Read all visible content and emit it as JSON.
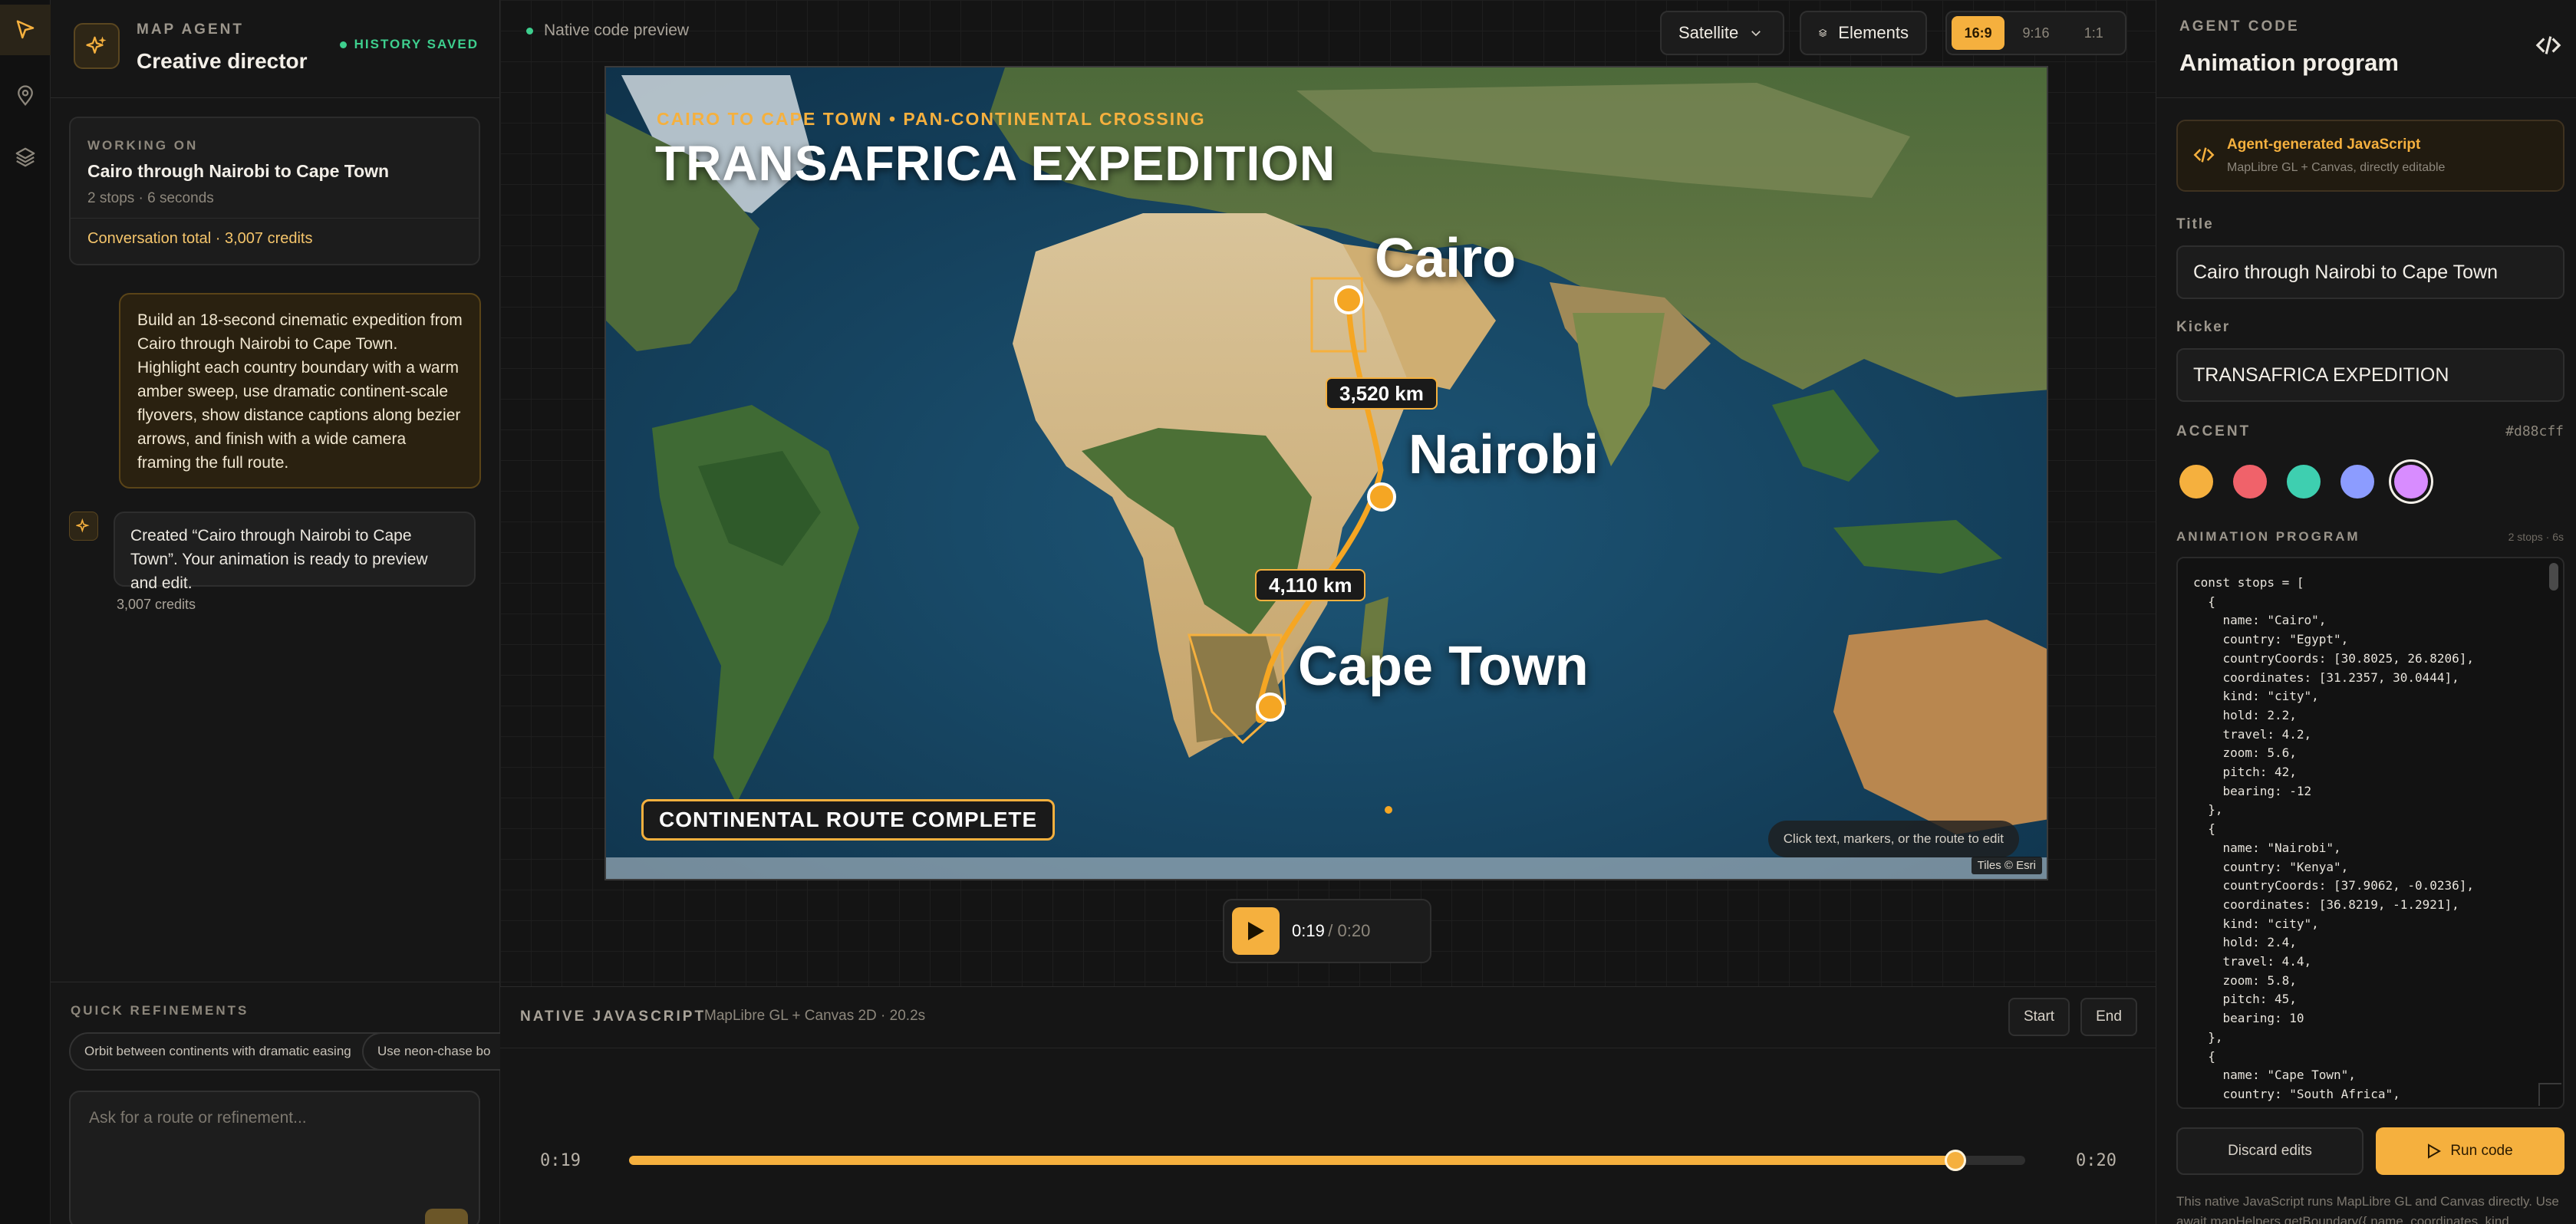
{
  "rail": {
    "items": [
      "cursor-icon",
      "map-pin-icon",
      "layers-icon"
    ]
  },
  "chat": {
    "kicker": "MAP AGENT",
    "title": "Creative director",
    "status": "HISTORY SAVED",
    "working_on": {
      "label": "WORKING ON",
      "title": "Cairo through Nairobi to Cape Town",
      "meta": "2 stops · 6 seconds",
      "total": "Conversation total · 3,007 credits"
    },
    "user_message": "Build an 18-second cinematic expedition from Cairo through Nairobi to Cape Town. Highlight each country boundary with a warm amber sweep, use dramatic continent-scale flyovers, show distance captions along bezier arrows, and finish with a wide camera framing the full route.",
    "agent_message": "Created “Cairo through Nairobi to Cape Town”. Your animation is ready to preview and edit.",
    "agent_credits": "3,007 credits",
    "refinements": {
      "label": "QUICK REFINEMENTS",
      "chips": [
        "Orbit between continents with dramatic easing",
        "Use neon-chase bo"
      ]
    },
    "prompt_placeholder": "Ask for a route or refinement..."
  },
  "stage": {
    "preview_label": "Native code preview",
    "basemap": "Satellite",
    "elements_label": "Elements",
    "ratios": [
      "16:9",
      "9:16",
      "1:1"
    ],
    "active_ratio": "16:9"
  },
  "map": {
    "kicker": "CAIRO TO CAPE TOWN • PAN-CONTINENTAL CROSSING",
    "title": "TRANSAFRICA EXPEDITION",
    "cities": [
      "Cairo",
      "Nairobi",
      "Cape Town"
    ],
    "distances": [
      "3,520 km",
      "4,110 km"
    ],
    "caption": "CONTINENTAL ROUTE COMPLETE",
    "hint": "Click text, markers, or the route to edit",
    "attribution": "Tiles © Esri"
  },
  "player": {
    "current": "0:19",
    "sep": "/",
    "total": "0:20"
  },
  "timeline": {
    "title": "NATIVE JAVASCRIPT",
    "subtitle": "MapLibre GL + Canvas 2D · 20.2s",
    "start_label": "Start",
    "end_label": "End",
    "time_left": "0:19",
    "time_right": "0:20",
    "progress": 0.95
  },
  "code_panel": {
    "kicker": "AGENT CODE",
    "title": "Animation program",
    "gen_title": "Agent-generated JavaScript",
    "gen_sub": "MapLibre GL + Canvas, directly editable",
    "title_label": "Title",
    "title_value": "Cairo through Nairobi to Cape Town",
    "kicker_label": "Kicker",
    "kicker_value": "TRANSAFRICA EXPEDITION",
    "accent_label": "ACCENT",
    "accent_value": "#d88cff",
    "swatches": [
      "#f5b03e",
      "#f0626a",
      "#3ecfb0",
      "#8c9cff",
      "#d88cff"
    ],
    "program_label": "ANIMATION PROGRAM",
    "program_meta": "2 stops · 6s",
    "code": "const stops = [\n  {\n    name: \"Cairo\",\n    country: \"Egypt\",\n    countryCoords: [30.8025, 26.8206],\n    coordinates: [31.2357, 30.0444],\n    kind: \"city\",\n    hold: 2.2,\n    travel: 4.2,\n    zoom: 5.6,\n    pitch: 42,\n    bearing: -12\n  },\n  {\n    name: \"Nairobi\",\n    country: \"Kenya\",\n    countryCoords: [37.9062, -0.0236],\n    coordinates: [36.8219, -1.2921],\n    kind: \"city\",\n    hold: 2.4,\n    travel: 4.4,\n    zoom: 5.8,\n    pitch: 45,\n    bearing: 10\n  },\n  {\n    name: \"Cape Town\",\n    country: \"South Africa\",",
    "discard_label": "Discard edits",
    "run_label": "Run code",
    "footnote": "This native JavaScript runs MapLibre GL and Canvas directly. Use await mapHelpers.getBoundary({ name, coordinates, kind"
  },
  "colors": {
    "accent": "#f5b03e",
    "status_green": "#3ecf8e"
  }
}
